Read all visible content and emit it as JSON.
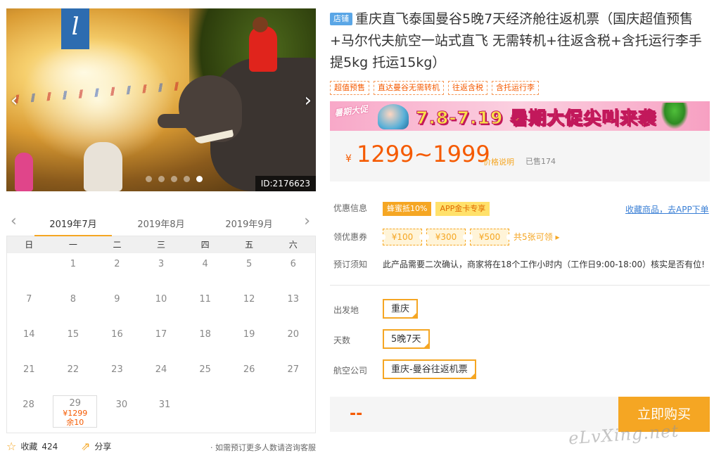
{
  "hero": {
    "image_id": "ID:2176623",
    "logo_letter": "l",
    "prev_arrow": "‹",
    "next_arrow": "›",
    "slide_count": 5,
    "active_slide": 4
  },
  "calendar": {
    "prev": "‹",
    "next": "›",
    "months": [
      "2019年7月",
      "2019年8月",
      "2019年9月"
    ],
    "active_month": 0,
    "weekdays": [
      "日",
      "一",
      "二",
      "三",
      "四",
      "五",
      "六"
    ],
    "weeks": [
      [
        "",
        "1",
        "2",
        "3",
        "4",
        "5",
        "6"
      ],
      [
        "7",
        "8",
        "9",
        "10",
        "11",
        "12",
        "13"
      ],
      [
        "14",
        "15",
        "16",
        "17",
        "18",
        "19",
        "20"
      ],
      [
        "21",
        "22",
        "23",
        "24",
        "25",
        "26",
        "27"
      ],
      [
        "28",
        "29",
        "30",
        "31",
        "",
        "",
        ""
      ]
    ],
    "available": {
      "day": "29",
      "price": "¥1299",
      "remaining": "余10"
    }
  },
  "bottom": {
    "fav_label": "收藏",
    "fav_count": "424",
    "share_label": "分享",
    "consult": "· 如需预订更多人数请咨询客服"
  },
  "product": {
    "shop_badge": "店铺",
    "title": "重庆直飞泰国曼谷5晚7天经济舱往返机票（国庆超值预售+马尔代夫航空一站式直飞 无需转机+往返含税+含托运行李手提5kg 托运15kg）",
    "tags": [
      "超值预售",
      "直达曼谷无需转机",
      "往返含税",
      "含托运行李"
    ]
  },
  "promo": {
    "label": "暑期大促",
    "text": "7.8-7.19 暑期大促尖叫来袭"
  },
  "price": {
    "currency": "¥",
    "range": "1299~1999",
    "note": "价格说明",
    "sold": "已售174"
  },
  "discount": {
    "label": "优惠信息",
    "badge1": "蜂蜜抵10%",
    "badge2": "APP金卡专享",
    "app_link": "收藏商品，去APP下单"
  },
  "coupons": {
    "label": "领优惠券",
    "items": [
      "¥100",
      "¥300",
      "¥500"
    ],
    "more": "共5张可领 ▸"
  },
  "notice": {
    "label": "预订须知",
    "text": "此产品需要二次确认，商家将在18个工作小时内（工作日9:00-18:00）核实是否有位!"
  },
  "options": {
    "departure_label": "出发地",
    "departure_value": "重庆",
    "days_label": "天数",
    "days_value": "5晚7天",
    "airline_label": "航空公司",
    "airline_value": "重庆-曼谷往返机票"
  },
  "buy": {
    "total": "--",
    "button": "立即购买"
  },
  "watermark": "eLvXing.net",
  "colors": {
    "accent": "#f5a623",
    "price": "#f55a00",
    "link": "#3a7fd5"
  }
}
